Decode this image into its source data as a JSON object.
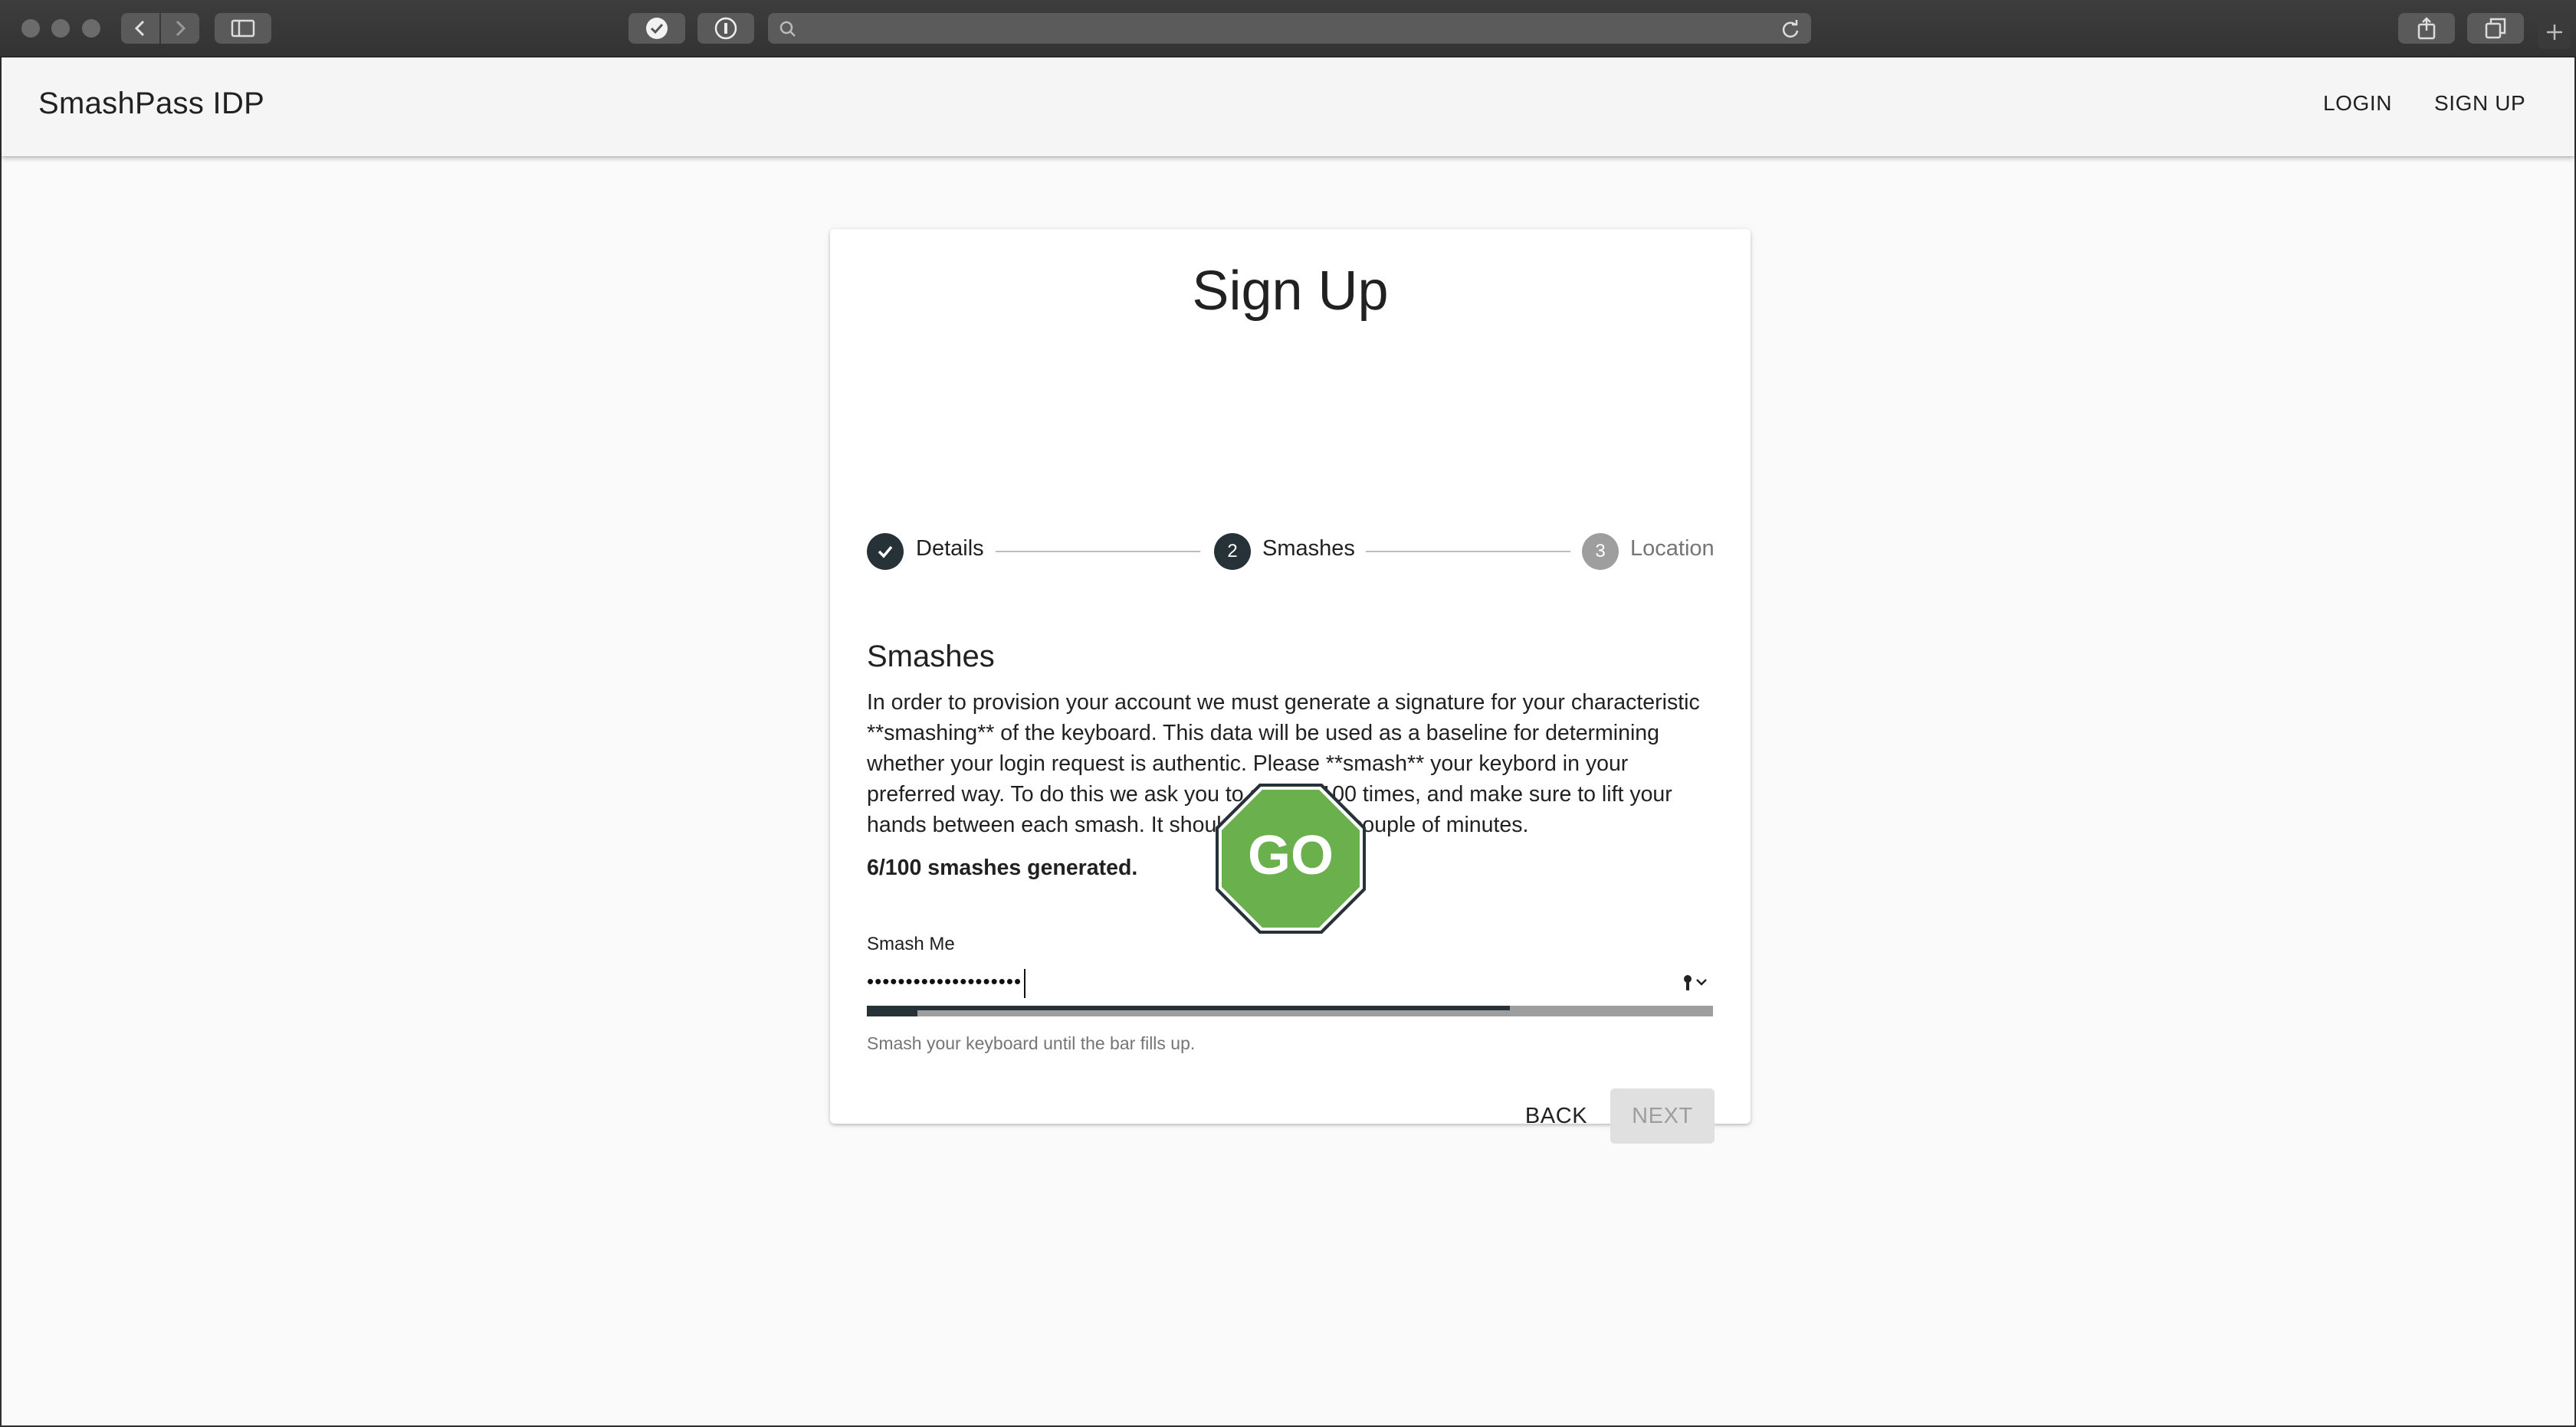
{
  "browser": {
    "address": "",
    "icons": [
      "back-icon",
      "forward-icon",
      "sidebar-icon",
      "checkmark-extension-icon",
      "password-manager-icon",
      "search-icon",
      "reload-icon",
      "share-icon",
      "tabs-icon",
      "new-tab-icon"
    ]
  },
  "header": {
    "brand": "SmashPass IDP",
    "login_label": "LOGIN",
    "signup_label": "SIGN UP"
  },
  "card": {
    "title": "Sign Up",
    "steps": [
      {
        "label": "Details",
        "state": "completed",
        "number": ""
      },
      {
        "label": "Smashes",
        "state": "active",
        "number": "2"
      },
      {
        "label": "Location",
        "state": "inactive",
        "number": "3"
      }
    ],
    "section_title": "Smashes",
    "description": "In order to provision your account we must generate a signature for your characteristic **smashing** of the keyboard. This data will be used as a baseline for determining whether your login request is authentic. Please **smash** your keybord in your preferred way. To do this we ask you to smash 100 times, and make sure to lift your hands between each smash. It should only take a couple of minutes.",
    "count_text": "6/100 smashes generated.",
    "go_label": "GO",
    "field_label": "Smash Me",
    "field_value": "••••••••••••••••••••",
    "helper_text": "Smash your keyboard until the bar fills up.",
    "progress_percent": 76,
    "back_label": "BACK",
    "next_label": "NEXT"
  },
  "colors": {
    "go_green": "#6ab04c",
    "step_dark": "#263238",
    "step_inactive": "#9e9e9e"
  }
}
